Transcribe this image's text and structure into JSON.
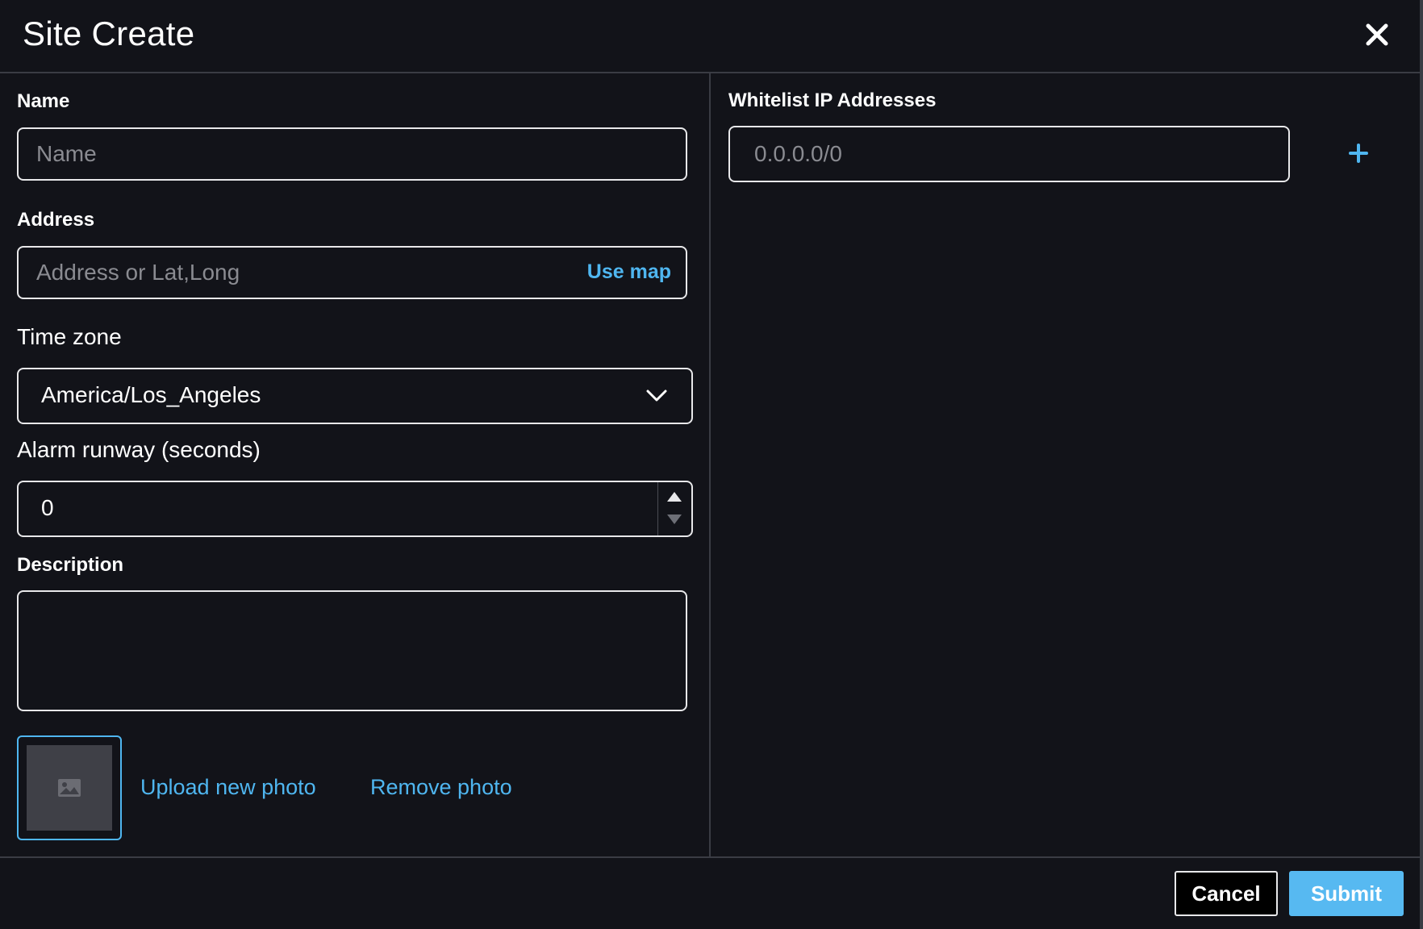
{
  "modal": {
    "title": "Site Create"
  },
  "form": {
    "name_label": "Name",
    "name_placeholder": "Name",
    "address_label": "Address",
    "address_placeholder": "Address or Lat,Long",
    "use_map_label": "Use map",
    "timezone_label": "Time zone",
    "timezone_value": "America/Los_Angeles",
    "alarm_runway_label": "Alarm runway (seconds)",
    "alarm_runway_value": "0",
    "description_label": "Description",
    "upload_photo_label": "Upload new photo",
    "remove_photo_label": "Remove photo"
  },
  "whitelist": {
    "label": "Whitelist IP Addresses",
    "placeholder": "0.0.0.0/0"
  },
  "footer": {
    "cancel_label": "Cancel",
    "submit_label": "Submit"
  },
  "colors": {
    "background": "#121319",
    "accent": "#4fb6f0",
    "submit": "#57b9f1",
    "border": "#e8e8ea",
    "divider": "#3a3c44"
  },
  "icons": {
    "close": "close-icon",
    "chevron": "chevron-down-icon",
    "image": "image-placeholder-icon",
    "add": "plus-icon"
  }
}
